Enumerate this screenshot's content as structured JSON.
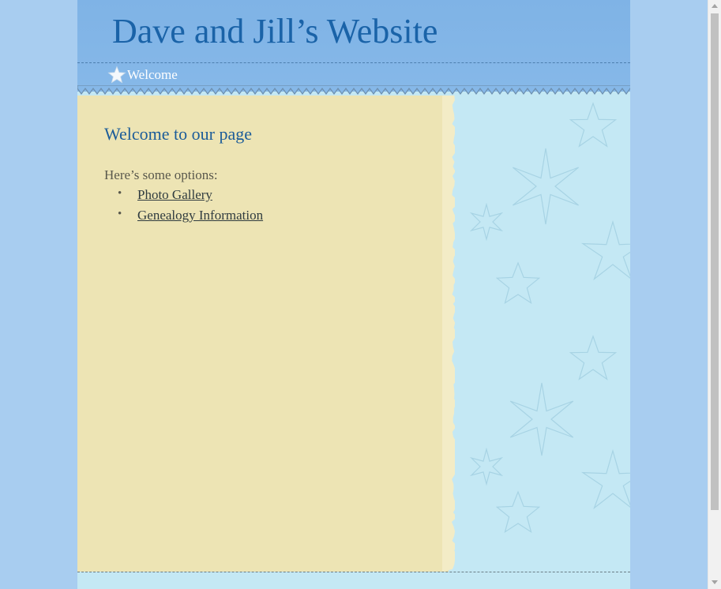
{
  "site": {
    "title": "Dave and Jill’s Website"
  },
  "nav": {
    "items": [
      {
        "label": "Welcome",
        "icon": "star-icon"
      }
    ]
  },
  "main": {
    "heading": "Welcome to our page",
    "intro": "Here’s some options:",
    "links": [
      {
        "label": "Photo Gallery"
      },
      {
        "label": "Genealogy Information"
      }
    ],
    "bullet": "•"
  },
  "colors": {
    "page_background": "#a8cdf0",
    "header": "#7fb3e6",
    "title": "#1a63a8",
    "content_panel": "#ede4b4",
    "sidebar": "#c4e8f4",
    "heading": "#1c5c99",
    "text": "#59584c",
    "link": "#2f3b3f"
  }
}
